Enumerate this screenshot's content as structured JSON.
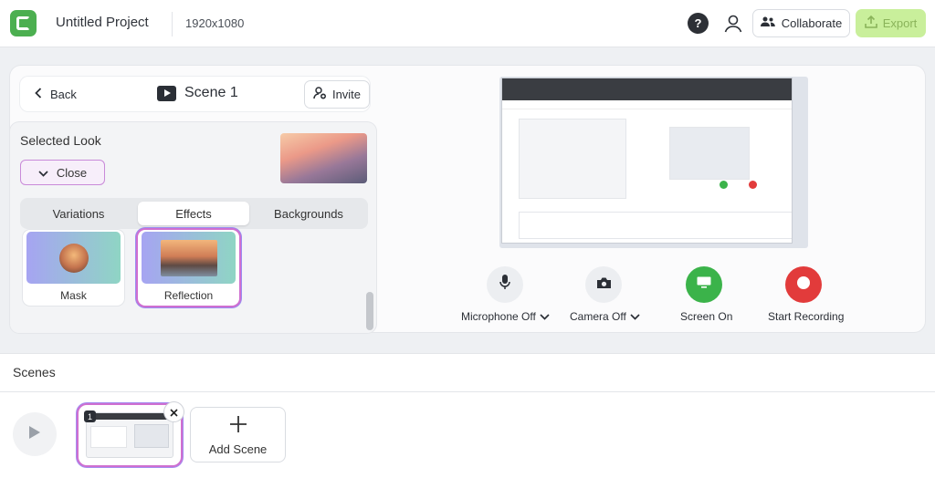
{
  "header": {
    "project_title": "Untitled Project",
    "resolution": "1920x1080",
    "help_label": "?",
    "collaborate_label": "Collaborate",
    "export_label": "Export"
  },
  "scene_panel": {
    "back_label": "Back",
    "scene_title": "Scene 1",
    "invite_label": "Invite"
  },
  "look": {
    "selected_look_label": "Selected Look",
    "close_label": "Close",
    "tabs": [
      "Variations",
      "Effects",
      "Backgrounds"
    ],
    "active_tab": "Effects",
    "effects": [
      {
        "label": "Mask",
        "selected": false
      },
      {
        "label": "Reflection",
        "selected": true
      }
    ]
  },
  "controls": {
    "microphone_label": "Microphone Off",
    "camera_label": "Camera Off",
    "screen_label": "Screen On",
    "record_label": "Start Recording",
    "colors": {
      "screen": "#3bb34a",
      "record": "#e23b3b"
    }
  },
  "scenes": {
    "section_label": "Scenes",
    "items": [
      {
        "number": "1",
        "selected": true
      }
    ],
    "add_scene_label": "Add Scene"
  },
  "icons": [
    "logo-icon",
    "chevron-left-icon",
    "clapper-icon",
    "invite-icon",
    "chevron-up-icon",
    "avatar-icon",
    "collaborate-icon",
    "export-icon",
    "microphone-icon",
    "camera-icon",
    "screen-icon",
    "record-icon",
    "chevron-down-icon",
    "play-icon",
    "close-icon",
    "plus-icon"
  ]
}
